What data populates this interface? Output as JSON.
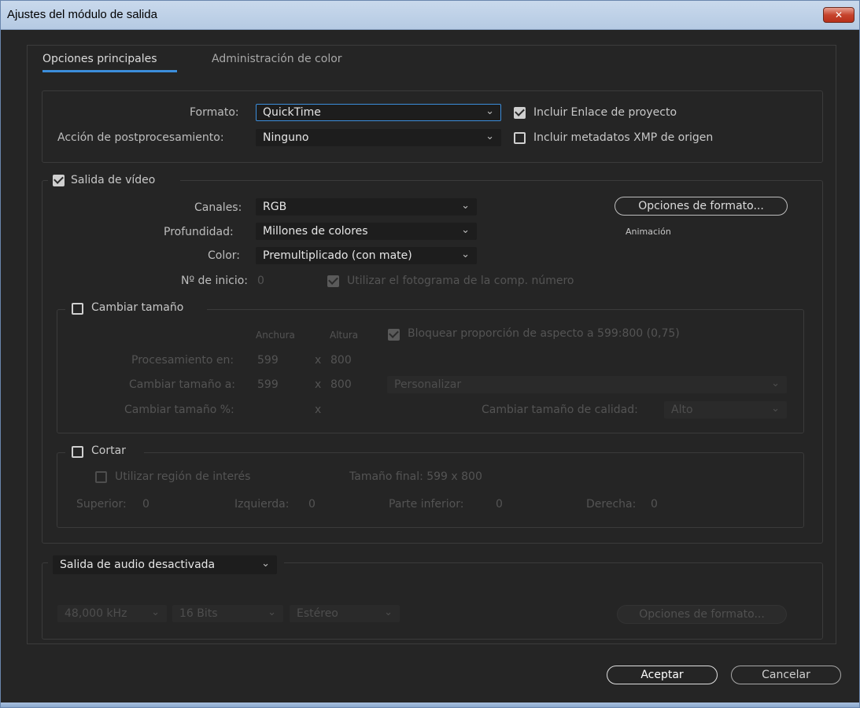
{
  "window": {
    "title": "Ajustes del módulo de salida",
    "close_symbol": "✕"
  },
  "tabs": [
    {
      "label": "Opciones principales",
      "active": true
    },
    {
      "label": "Administración de color",
      "active": false
    }
  ],
  "main_options": {
    "format_label": "Formato:",
    "format_value": "QuickTime",
    "post_label": "Acción de postprocesamiento:",
    "post_value": "Ninguno",
    "include_link_label": "Incluir Enlace de proyecto",
    "include_link_checked": true,
    "include_xmp_label": "Incluir metadatos XMP de origen",
    "include_xmp_checked": false
  },
  "video": {
    "section_label": "Salida de vídeo",
    "checked": true,
    "channels_label": "Canales:",
    "channels_value": "RGB",
    "depth_label": "Profundidad:",
    "depth_value": "Millones de colores",
    "color_label": "Color:",
    "color_value": "Premultiplicado (con mate)",
    "start_label": "Nº de inicio:",
    "start_value": "0",
    "use_comp_frame_label": "Utilizar el fotograma de la comp. número",
    "format_options_button": "Opciones de formato...",
    "codec_label": "Animación"
  },
  "resize": {
    "section_label": "Cambiar tamaño",
    "checked": false,
    "width_header": "Anchura",
    "height_header": "Altura",
    "lock_aspect_label": "Bloquear proporción de aspecto a 599:800 (0,75)",
    "render_at_label": "Procesamiento en:",
    "render_w": "599",
    "render_h": "800",
    "resize_to_label": "Cambiar tamaño a:",
    "resize_w": "599",
    "resize_h": "800",
    "preset_value": "Personalizar",
    "resize_pct_label": "Cambiar tamaño %:",
    "x_symbol": "x",
    "quality_label": "Cambiar tamaño de calidad:",
    "quality_value": "Alto"
  },
  "crop": {
    "section_label": "Cortar",
    "checked": false,
    "use_roi_label": "Utilizar región de interés",
    "final_size_label": "Tamaño final: 599 x 800",
    "top_label": "Superior:",
    "top_value": "0",
    "left_label": "Izquierda:",
    "left_value": "0",
    "bottom_label": "Parte inferior:",
    "bottom_value": "0",
    "right_label": "Derecha:",
    "right_value": "0"
  },
  "audio": {
    "dropdown_value": "Salida de audio desactivada",
    "rate_value": "48,000 kHz",
    "bits_value": "16 Bits",
    "channels_value": "Estéreo",
    "format_options_button": "Opciones de formato..."
  },
  "footer": {
    "ok_label": "Aceptar",
    "cancel_label": "Cancelar"
  },
  "chevron_symbol": "⌄",
  "colors": {
    "accent": "#3c8edc",
    "background": "#252525",
    "field": "#1d1d1d"
  }
}
